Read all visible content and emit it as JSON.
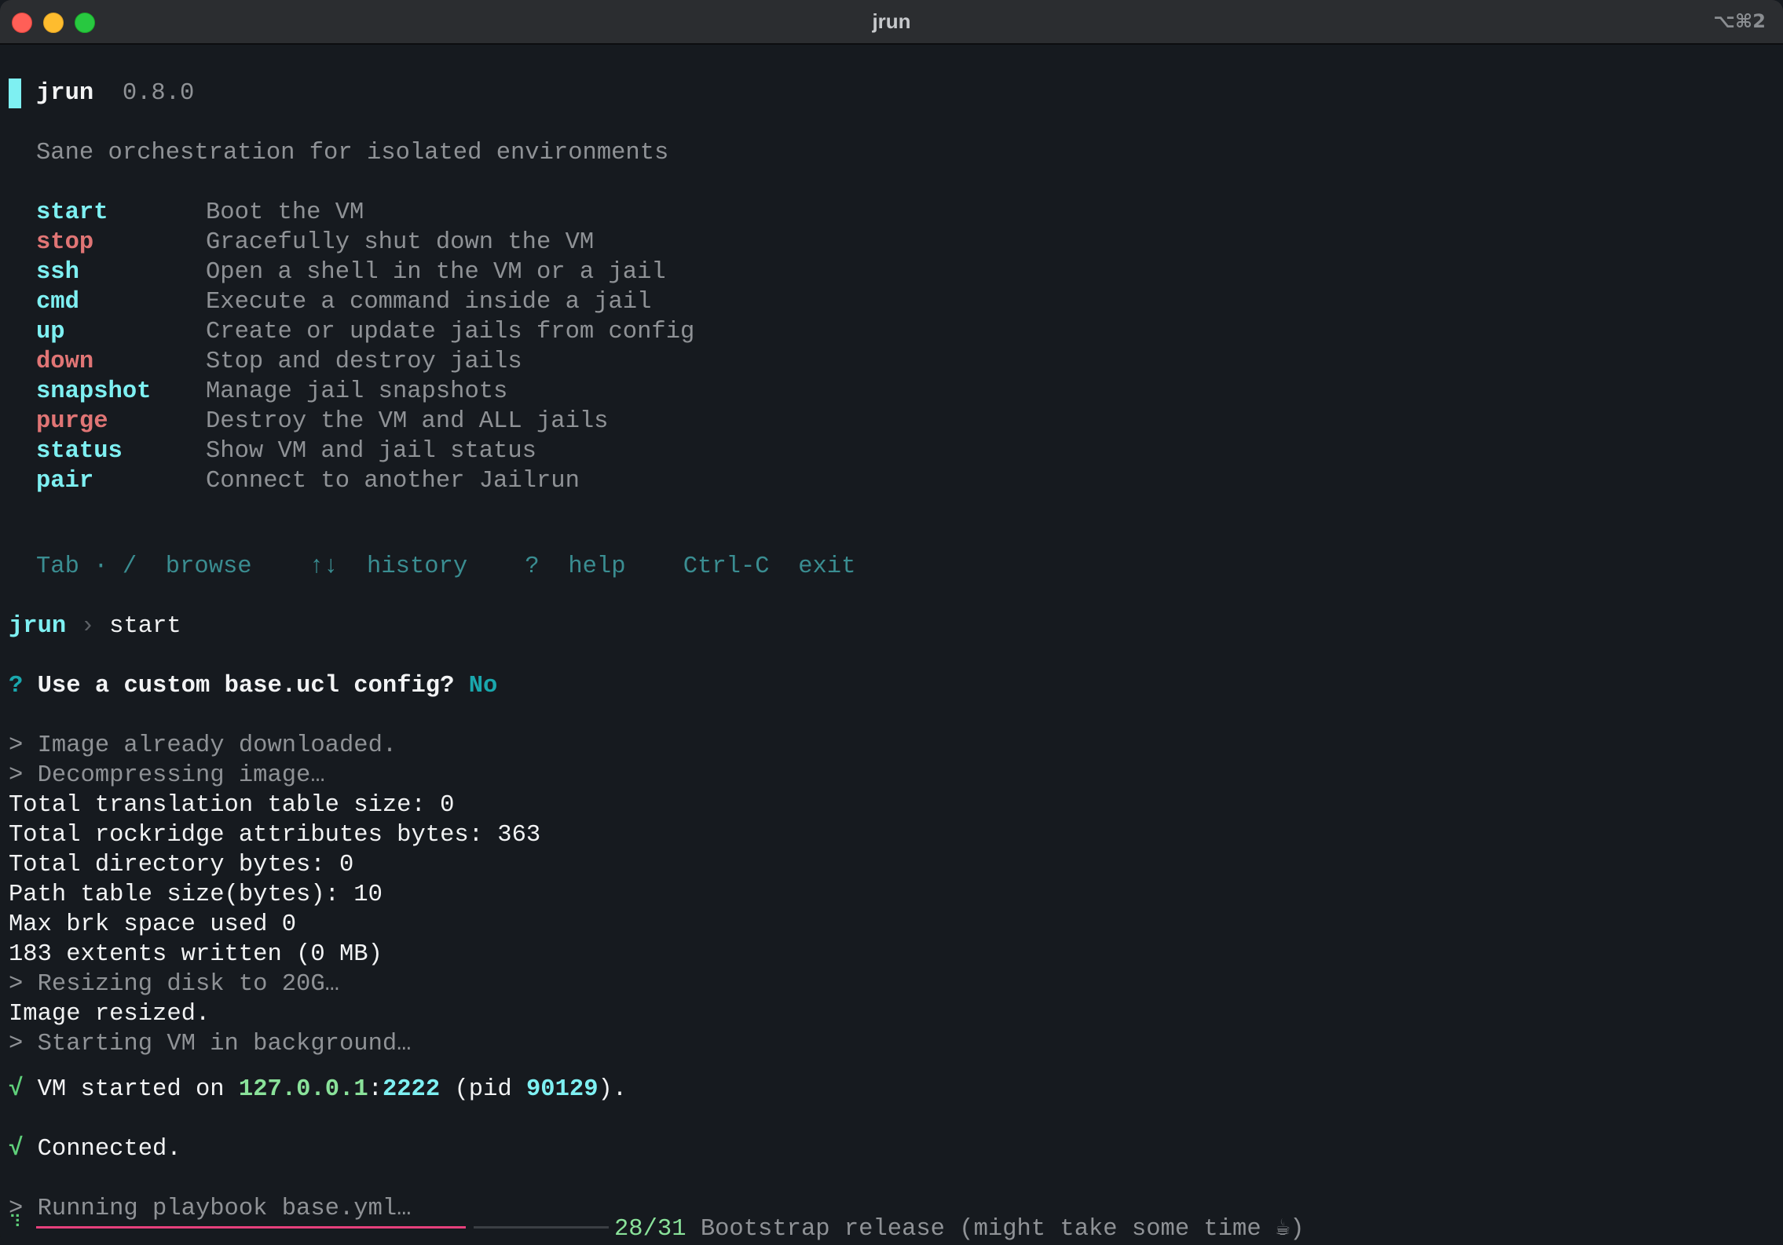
{
  "window": {
    "title": "jrun",
    "shortcut": "⌥⌘2"
  },
  "header": {
    "name": "jrun",
    "version": "0.8.0",
    "tagline": "Sane orchestration for isolated environments"
  },
  "commands": [
    {
      "name": "start",
      "desc": "Boot the VM",
      "color": "#7ef0f2"
    },
    {
      "name": "stop",
      "desc": "Gracefully shut down the VM",
      "color": "#e07575"
    },
    {
      "name": "ssh",
      "desc": "Open a shell in the VM or a jail",
      "color": "#7ef0f2"
    },
    {
      "name": "cmd",
      "desc": "Execute a command inside a jail",
      "color": "#7ef0f2"
    },
    {
      "name": "up",
      "desc": "Create or update jails from config",
      "color": "#7ef0f2"
    },
    {
      "name": "down",
      "desc": "Stop and destroy jails",
      "color": "#e07575"
    },
    {
      "name": "snapshot",
      "desc": "Manage jail snapshots",
      "color": "#7ef0f2"
    },
    {
      "name": "purge",
      "desc": "Destroy the VM and ALL jails",
      "color": "#e07575"
    },
    {
      "name": "status",
      "desc": "Show VM and jail status",
      "color": "#7ef0f2"
    },
    {
      "name": "pair",
      "desc": "Connect to another Jailrun",
      "color": "#7ef0f2"
    }
  ],
  "hints": {
    "tab_key": "Tab",
    "dot": "·",
    "slash_key": "/",
    "browse": "browse",
    "arrows_key": "↑↓",
    "history": "history",
    "help_key": "?",
    "help": "help",
    "exit_key": "Ctrl-C",
    "exit": "exit"
  },
  "prompt": {
    "name": "jrun",
    "separator": "›",
    "input": "start"
  },
  "question": {
    "mark": "?",
    "text": "Use a custom base.ucl config?",
    "answer": "No"
  },
  "log": [
    {
      "text": "> Image already downloaded.",
      "kind": "step"
    },
    {
      "text": "> Decompressing image…",
      "kind": "step"
    },
    {
      "text": "Total translation table size: 0",
      "kind": "out"
    },
    {
      "text": "Total rockridge attributes bytes: 363",
      "kind": "out"
    },
    {
      "text": "Total directory bytes: 0",
      "kind": "out"
    },
    {
      "text": "Path table size(bytes): 10",
      "kind": "out"
    },
    {
      "text": "Max brk space used 0",
      "kind": "out"
    },
    {
      "text": "183 extents written (0 MB)",
      "kind": "out"
    },
    {
      "text": "> Resizing disk to 20G…",
      "kind": "step"
    },
    {
      "text": "Image resized.",
      "kind": "out"
    },
    {
      "text": "> Starting VM in background…",
      "kind": "step"
    }
  ],
  "vm_started": {
    "check": "√",
    "prefix": "VM started on",
    "host": "127.0.0.1",
    "colon": ":",
    "port": "2222",
    "pid_open": "(pid",
    "pid": "90129",
    "pid_close": ")."
  },
  "connected": {
    "check": "√",
    "text": "Connected."
  },
  "playbook": {
    "text": "> Running playbook base.yml…"
  },
  "progress": {
    "spinner": "⠹",
    "current": 28,
    "total": 31,
    "label": "28/31",
    "task": "Bootstrap release (might take some time ☕)"
  }
}
